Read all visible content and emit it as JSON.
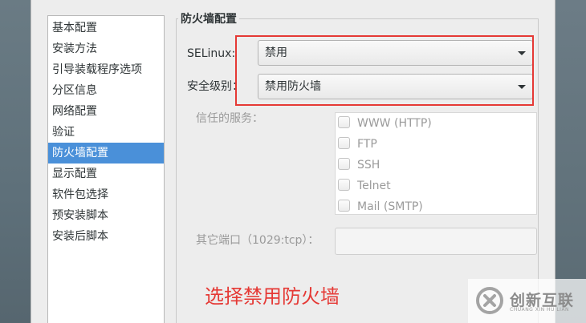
{
  "sidebar": {
    "items": [
      {
        "label": "基本配置",
        "selected": false
      },
      {
        "label": "安装方法",
        "selected": false
      },
      {
        "label": "引导装载程序选项",
        "selected": false
      },
      {
        "label": "分区信息",
        "selected": false
      },
      {
        "label": "网络配置",
        "selected": false
      },
      {
        "label": "验证",
        "selected": false
      },
      {
        "label": "防火墙配置",
        "selected": true
      },
      {
        "label": "显示配置",
        "selected": false
      },
      {
        "label": "软件包选择",
        "selected": false
      },
      {
        "label": "预安装脚本",
        "selected": false
      },
      {
        "label": "安装后脚本",
        "selected": false
      }
    ]
  },
  "firewall": {
    "title": "防火墙配置",
    "selinux_label": "SELinux:",
    "selinux_value": "禁用",
    "security_label": "安全级别：",
    "security_value": "禁用防火墙",
    "services_label": "信任的服务：",
    "services": [
      {
        "label": "WWW (HTTP)",
        "checked": false
      },
      {
        "label": "FTP",
        "checked": false
      },
      {
        "label": "SSH",
        "checked": false
      },
      {
        "label": "Telnet",
        "checked": false
      },
      {
        "label": "Mail (SMTP)",
        "checked": false
      }
    ],
    "ports_label": "其它端口（1029:tcp）：",
    "ports_value": ""
  },
  "annotation": {
    "text": "选择禁用防火墙",
    "color": "#e53935"
  },
  "colors": {
    "selection": "#4a90d9",
    "highlight": "#e53935"
  },
  "watermark": {
    "name": "创新互联",
    "sub": "CHUANG XIN HU LIAN"
  }
}
